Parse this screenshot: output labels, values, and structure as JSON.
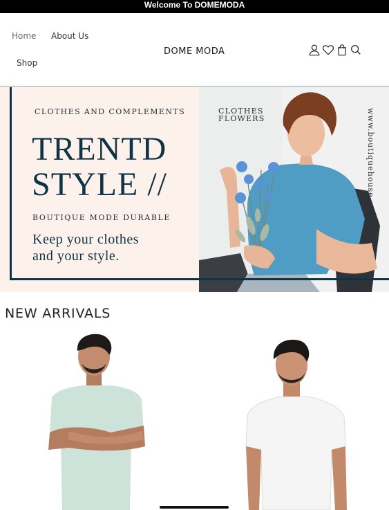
{
  "announcement": "Welcome To DOMEMODA",
  "nav": {
    "home": "Home",
    "about": "About Us",
    "shop": "Shop"
  },
  "brand": {
    "logo_text": "DOME MODA"
  },
  "header_icons": [
    "user-icon",
    "heart-icon",
    "bag-icon",
    "search-icon"
  ],
  "banner": {
    "subtitle_top": "CLOTHES AND COMPLEMENTS",
    "headline_line1": "TRENTD",
    "headline_line2": "STYLE //",
    "subtitle_bottom": "BOUTIQUE MODE DURABLE",
    "tagline_line1": "Keep your clothes",
    "tagline_line2": "and your style.",
    "side_label_line1": "CLOTHES",
    "side_label_line2": "FLOWERS",
    "vertical_url": "www.boutiquehouse.com",
    "accent_color": "#0f3345",
    "panel_color": "#fdf1ec"
  },
  "new_arrivals": {
    "title": "NEW ARRIVALS",
    "products": [
      {
        "shirt_color": "#cfe3dc"
      },
      {
        "shirt_color": "#f6f6f6"
      }
    ]
  }
}
